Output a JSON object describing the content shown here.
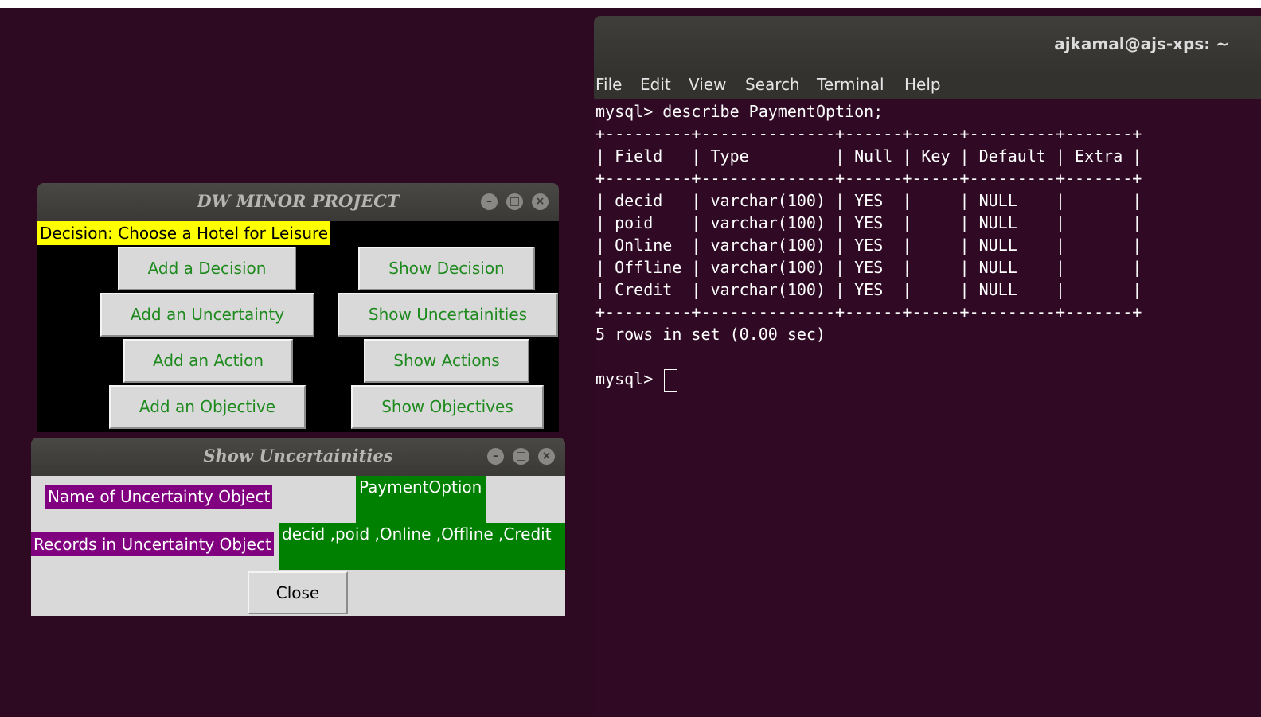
{
  "terminal": {
    "title": "ajkamal@ajs-xps: ~",
    "menu": [
      "File",
      "Edit",
      "View",
      "Search",
      "Terminal",
      "Help"
    ],
    "lines": [
      "mysql> describe PaymentOption;",
      "+---------+--------------+------+-----+---------+-------+",
      "| Field   | Type         | Null | Key | Default | Extra |",
      "+---------+--------------+------+-----+---------+-------+",
      "| decid   | varchar(100) | YES  |     | NULL    |       |",
      "| poid    | varchar(100) | YES  |     | NULL    |       |",
      "| Online  | varchar(100) | YES  |     | NULL    |       |",
      "| Offline | varchar(100) | YES  |     | NULL    |       |",
      "| Credit  | varchar(100) | YES  |     | NULL    |       |",
      "+---------+--------------+------+-----+---------+-------+",
      "5 rows in set (0.00 sec)",
      "",
      "mysql> "
    ]
  },
  "main_window": {
    "title": "DW  MINOR  PROJECT",
    "decision_label": "Decision: Choose a Hotel for Leisure",
    "buttons": {
      "add_decision": "Add a Decision",
      "show_decision": "Show Decision",
      "add_uncertainty": "Add an Uncertainty",
      "show_uncertainties": "Show Uncertainities",
      "add_action": "Add an Action",
      "show_actions": "Show Actions",
      "add_objective": "Add an Objective",
      "show_objectives": "Show Objectives"
    }
  },
  "uncertainties_window": {
    "title": "Show  Uncertainities",
    "name_label": "Name of Uncertainty Object",
    "name_value": "PaymentOption",
    "records_label": "Records in Uncertainty Object",
    "records_value": "decid ,poid ,Online ,Offline ,Credit",
    "close_label": "Close"
  },
  "window_controls": {
    "minimize_glyph": "–",
    "maximize_glyph": "□",
    "close_glyph": "×"
  },
  "colors": {
    "desktop_bg": "#2d0922",
    "terminal_bg": "#300a24",
    "decision_bg": "#ffff00",
    "button_text": "#1e8a1e",
    "purple_label": "#800080",
    "green_value": "#008000"
  }
}
